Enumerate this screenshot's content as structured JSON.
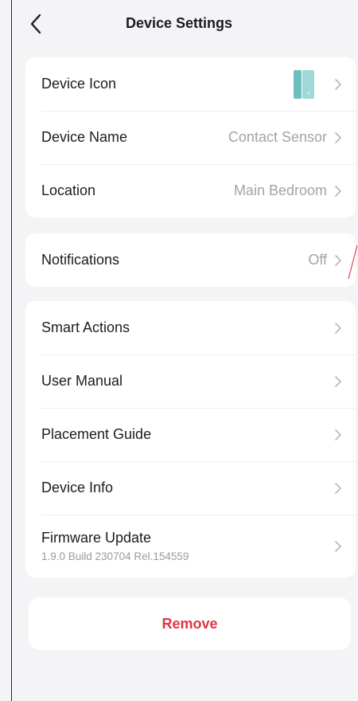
{
  "header": {
    "title": "Device Settings"
  },
  "group1": [
    {
      "label": "Device Icon",
      "value": ""
    },
    {
      "label": "Device Name",
      "value": "Contact Sensor"
    },
    {
      "label": "Location",
      "value": "Main Bedroom"
    }
  ],
  "group2": [
    {
      "label": "Notifications",
      "value": "Off"
    }
  ],
  "group3": [
    {
      "label": "Smart Actions"
    },
    {
      "label": "User Manual"
    },
    {
      "label": "Placement Guide"
    },
    {
      "label": "Device Info"
    },
    {
      "label": "Firmware Update",
      "subtitle": "1.9.0 Build 230704 Rel.154559"
    }
  ],
  "remove": {
    "label": "Remove"
  },
  "colors": {
    "background": "#f4f4f6",
    "card": "#ffffff",
    "remove_text": "#e03346",
    "device_icon": "#7fc9c9"
  },
  "icons": {
    "back": "chevron-left-icon",
    "row_arrow": "chevron-right-icon",
    "device": "contact-sensor-icon"
  }
}
